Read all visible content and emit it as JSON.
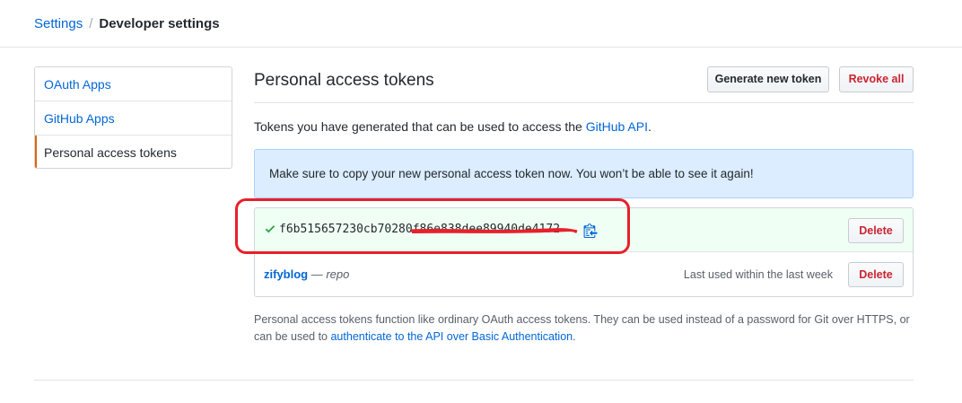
{
  "breadcrumb": {
    "parent": "Settings",
    "separator": "/",
    "current": "Developer settings"
  },
  "sidebar": {
    "items": [
      {
        "label": "OAuth Apps",
        "selected": false
      },
      {
        "label": "GitHub Apps",
        "selected": false
      },
      {
        "label": "Personal access tokens",
        "selected": true
      }
    ],
    "selected_accent": "#e36209"
  },
  "main": {
    "title": "Personal access tokens",
    "generate_button": "Generate new token",
    "revoke_button": "Revoke all",
    "intro_text": "Tokens you have generated that can be used to access the ",
    "intro_link": "GitHub API",
    "intro_end": "."
  },
  "flash": {
    "message": "Make sure to copy your new personal access token now. You won’t be able to see it again!"
  },
  "new_token": {
    "status_icon": "check-icon",
    "value": "f6b515657230cb70280f86e838dee89940de4172",
    "copy_icon": "clippy-icon",
    "delete_label": "Delete"
  },
  "tokens": [
    {
      "name": "zifyblog",
      "dash": " — ",
      "scope": "repo",
      "last_used": "Last used within the last week",
      "delete_label": "Delete"
    }
  ],
  "note": {
    "text": "Personal access tokens function like ordinary OAuth access tokens. They can be used instead of a password for Git over HTTPS, or can be used to ",
    "link": "authenticate to the API over Basic Authentication",
    "end": "."
  },
  "colors": {
    "link": "#0366d6",
    "danger": "#cb2431",
    "flash_bg": "#dbedff",
    "new_token_bg": "#f0fff4",
    "success": "#28a745",
    "annotation_red": "#e8202a"
  }
}
